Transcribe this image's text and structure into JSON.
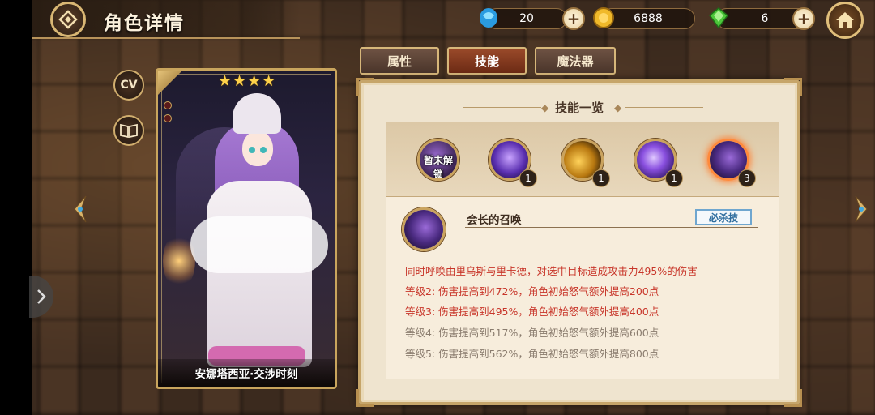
{
  "header": {
    "title": "角色详情",
    "back_icon": "diamond-back-icon"
  },
  "currencies": [
    {
      "name": "crystal",
      "icon": "blue-crystal-icon",
      "value": "20"
    },
    {
      "name": "gold",
      "icon": "gold-coin-icon",
      "value": "6888"
    },
    {
      "name": "gem",
      "icon": "green-gem-icon",
      "value": "6"
    }
  ],
  "side_buttons": {
    "cv": "CV",
    "book_icon": "book-icon"
  },
  "card": {
    "stars": "★★★★",
    "name": "安娜塔西亚·交涉时刻"
  },
  "tabs": [
    {
      "label": "属性",
      "active": false
    },
    {
      "label": "技能",
      "active": true
    },
    {
      "label": "魔法器",
      "active": false
    }
  ],
  "panel": {
    "title": "技能一览",
    "skills": [
      {
        "label": "暂未解锁",
        "level": "",
        "locked": true,
        "color": "#5a3a7a"
      },
      {
        "label": "",
        "level": "1",
        "locked": false,
        "color": "#6a3fc4"
      },
      {
        "label": "",
        "level": "1",
        "locked": false,
        "color": "#c8901a"
      },
      {
        "label": "",
        "level": "1",
        "locked": false,
        "color": "#7a3fc8"
      },
      {
        "label": "",
        "level": "3",
        "locked": false,
        "selected": true,
        "color": "#5b3480"
      }
    ],
    "selected_skill": {
      "name": "会长的召唤",
      "type": "必杀技",
      "description": "同时呼唤由里乌斯与里卡德，对选中目标造成攻击力495%的伤害",
      "levels": [
        {
          "text": "等级2:  伤害提高到472%，角色初始怒气额外提高200点",
          "unlocked": true
        },
        {
          "text": "等级3:  伤害提高到495%，角色初始怒气额外提高400点",
          "unlocked": true
        },
        {
          "text": "等级4:  伤害提高到517%，角色初始怒气额外提高600点",
          "unlocked": false
        },
        {
          "text": "等级5:  伤害提高到562%，角色初始怒气额外提高800点",
          "unlocked": false
        }
      ]
    }
  },
  "colors": {
    "active_tab": "#8a3c1e",
    "unlocked_text": "#c8362a",
    "locked_text": "#8a7c6e",
    "skill_type_border": "#6fa6cf"
  }
}
